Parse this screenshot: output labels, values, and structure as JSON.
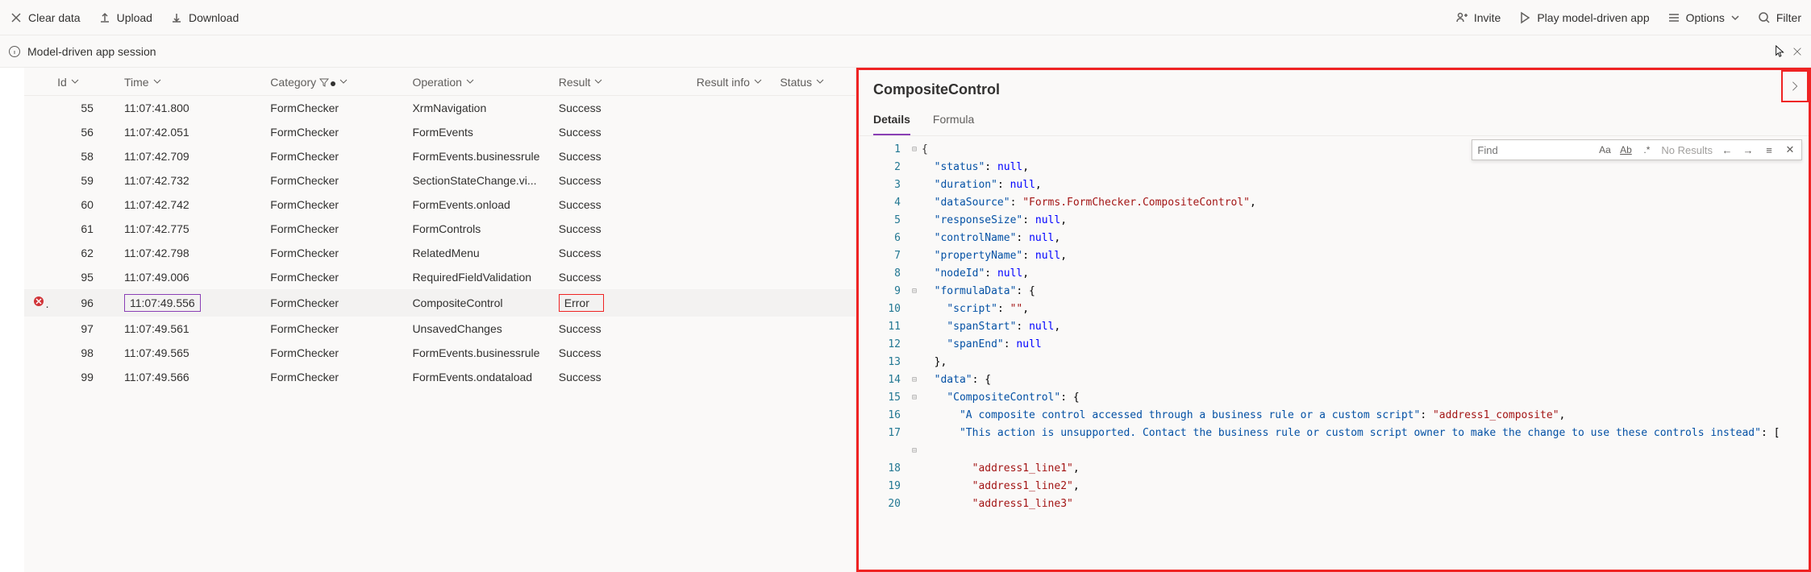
{
  "toolbar": {
    "clear_data": "Clear data",
    "upload": "Upload",
    "download": "Download",
    "invite": "Invite",
    "play_mda": "Play model-driven app",
    "options": "Options",
    "filter": "Filter"
  },
  "session": {
    "label": "Model-driven app session"
  },
  "columns": {
    "id": "Id",
    "time": "Time",
    "category": "Category",
    "operation": "Operation",
    "result": "Result",
    "result_info": "Result info",
    "status": "Status"
  },
  "rows": [
    {
      "id": "55",
      "time": "11:07:41.800",
      "category": "FormChecker",
      "operation": "XrmNavigation",
      "result": "Success",
      "err": false
    },
    {
      "id": "56",
      "time": "11:07:42.051",
      "category": "FormChecker",
      "operation": "FormEvents",
      "result": "Success",
      "err": false
    },
    {
      "id": "58",
      "time": "11:07:42.709",
      "category": "FormChecker",
      "operation": "FormEvents.businessrule",
      "result": "Success",
      "err": false
    },
    {
      "id": "59",
      "time": "11:07:42.732",
      "category": "FormChecker",
      "operation": "SectionStateChange.vi...",
      "result": "Success",
      "err": false
    },
    {
      "id": "60",
      "time": "11:07:42.742",
      "category": "FormChecker",
      "operation": "FormEvents.onload",
      "result": "Success",
      "err": false
    },
    {
      "id": "61",
      "time": "11:07:42.775",
      "category": "FormChecker",
      "operation": "FormControls",
      "result": "Success",
      "err": false
    },
    {
      "id": "62",
      "time": "11:07:42.798",
      "category": "FormChecker",
      "operation": "RelatedMenu",
      "result": "Success",
      "err": false
    },
    {
      "id": "95",
      "time": "11:07:49.006",
      "category": "FormChecker",
      "operation": "RequiredFieldValidation",
      "result": "Success",
      "err": false
    },
    {
      "id": "96",
      "time": "11:07:49.556",
      "category": "FormChecker",
      "operation": "CompositeControl",
      "result": "Error",
      "err": true,
      "sel": true
    },
    {
      "id": "97",
      "time": "11:07:49.561",
      "category": "FormChecker",
      "operation": "UnsavedChanges",
      "result": "Success",
      "err": false
    },
    {
      "id": "98",
      "time": "11:07:49.565",
      "category": "FormChecker",
      "operation": "FormEvents.businessrule",
      "result": "Success",
      "err": false
    },
    {
      "id": "99",
      "time": "11:07:49.566",
      "category": "FormChecker",
      "operation": "FormEvents.ondataload",
      "result": "Success",
      "err": false
    }
  ],
  "right": {
    "title": "CompositeControl",
    "tabs": {
      "details": "Details",
      "formula": "Formula"
    },
    "find": {
      "placeholder": "Find",
      "no_results": "No Results"
    }
  },
  "code": [
    {
      "n": "1",
      "g": "⊟",
      "t": "{",
      "cls": ""
    },
    {
      "n": "2",
      "g": "",
      "html": "  <span class='j-key'>\"status\"</span><span class='j-punc'>: </span><span class='j-kw'>null</span><span class='j-punc'>,</span>"
    },
    {
      "n": "3",
      "g": "",
      "html": "  <span class='j-key'>\"duration\"</span><span class='j-punc'>: </span><span class='j-kw'>null</span><span class='j-punc'>,</span>"
    },
    {
      "n": "4",
      "g": "",
      "html": "  <span class='j-key'>\"dataSource\"</span><span class='j-punc'>: </span><span class='j-str'>\"Forms.FormChecker.CompositeControl\"</span><span class='j-punc'>,</span>"
    },
    {
      "n": "5",
      "g": "",
      "html": "  <span class='j-key'>\"responseSize\"</span><span class='j-punc'>: </span><span class='j-kw'>null</span><span class='j-punc'>,</span>"
    },
    {
      "n": "6",
      "g": "",
      "html": "  <span class='j-key'>\"controlName\"</span><span class='j-punc'>: </span><span class='j-kw'>null</span><span class='j-punc'>,</span>"
    },
    {
      "n": "7",
      "g": "",
      "html": "  <span class='j-key'>\"propertyName\"</span><span class='j-punc'>: </span><span class='j-kw'>null</span><span class='j-punc'>,</span>"
    },
    {
      "n": "8",
      "g": "",
      "html": "  <span class='j-key'>\"nodeId\"</span><span class='j-punc'>: </span><span class='j-kw'>null</span><span class='j-punc'>,</span>"
    },
    {
      "n": "9",
      "g": "⊟",
      "html": "  <span class='j-key'>\"formulaData\"</span><span class='j-punc'>: {</span>"
    },
    {
      "n": "10",
      "g": "",
      "html": "    <span class='j-key'>\"script\"</span><span class='j-punc'>: </span><span class='j-str'>\"\"</span><span class='j-punc'>,</span>"
    },
    {
      "n": "11",
      "g": "",
      "html": "    <span class='j-key'>\"spanStart\"</span><span class='j-punc'>: </span><span class='j-kw'>null</span><span class='j-punc'>,</span>"
    },
    {
      "n": "12",
      "g": "",
      "html": "    <span class='j-key'>\"spanEnd\"</span><span class='j-punc'>: </span><span class='j-kw'>null</span>"
    },
    {
      "n": "13",
      "g": "",
      "html": "  <span class='j-punc'>},</span>"
    },
    {
      "n": "14",
      "g": "⊟",
      "html": "  <span class='j-key'>\"data\"</span><span class='j-punc'>: {</span>"
    },
    {
      "n": "15",
      "g": "⊟",
      "html": "    <span class='j-key'>\"CompositeControl\"</span><span class='j-punc'>: {</span>"
    },
    {
      "n": "16",
      "g": "",
      "html": "      <span class='j-key'>\"A composite control accessed through a business rule or a custom script\"</span><span class='j-punc'>: </span><span class='j-str'>\"address1_composite\"</span><span class='j-punc'>,</span>"
    },
    {
      "n": "17",
      "g": "",
      "html": "      <span class='j-key'>\"This action is unsupported. Contact the business rule or custom script owner to make the change to use these controls instead\"</span><span class='j-punc'>: [</span>"
    },
    {
      "n": "",
      "g": "⊟",
      "html": ""
    },
    {
      "n": "18",
      "g": "",
      "html": "        <span class='j-str'>\"address1_line1\"</span><span class='j-punc'>,</span>"
    },
    {
      "n": "19",
      "g": "",
      "html": "        <span class='j-str'>\"address1_line2\"</span><span class='j-punc'>,</span>"
    },
    {
      "n": "20",
      "g": "",
      "html": "        <span class='j-str'>\"address1_line3\"</span>"
    }
  ]
}
